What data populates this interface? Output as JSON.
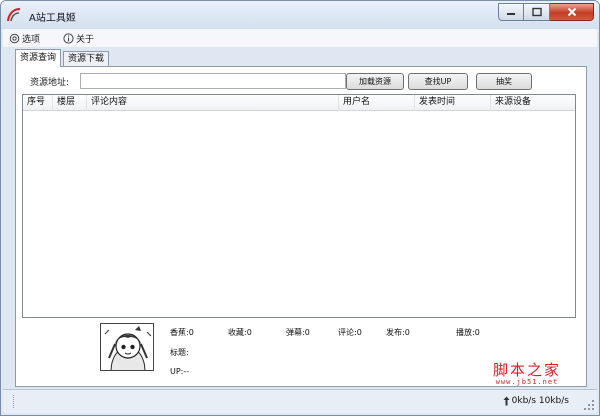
{
  "window": {
    "title": "A站工具姬"
  },
  "menu": {
    "options_label": "选项",
    "about_label": "关于"
  },
  "tabs": [
    {
      "label": "资源查询"
    },
    {
      "label": "资源下载"
    }
  ],
  "query": {
    "address_label": "资源地址:",
    "address_value": "",
    "load_button": "加载资源",
    "find_up_button": "查找UP",
    "lottery_button": "抽奖"
  },
  "table": {
    "columns": [
      "序号",
      "楼层",
      "评论内容",
      "用户名",
      "发表时间",
      "来源设备"
    ],
    "rows": []
  },
  "info": {
    "bananas": "香蕉:0",
    "favorites": "收藏:0",
    "danmaku": "弹幕:0",
    "comments": "评论:0",
    "published": "发布:0",
    "plays": "播放:0",
    "title": "标题:",
    "up": "UP:--"
  },
  "watermark": {
    "main": "脚本之家",
    "url": "www.jb51.net"
  },
  "status": {
    "speed": "0kb/s 10kb/s"
  },
  "colors": {
    "accent": "#dd1f26",
    "close_button": "#c53c25",
    "window_bg": "#dfe8f2"
  }
}
